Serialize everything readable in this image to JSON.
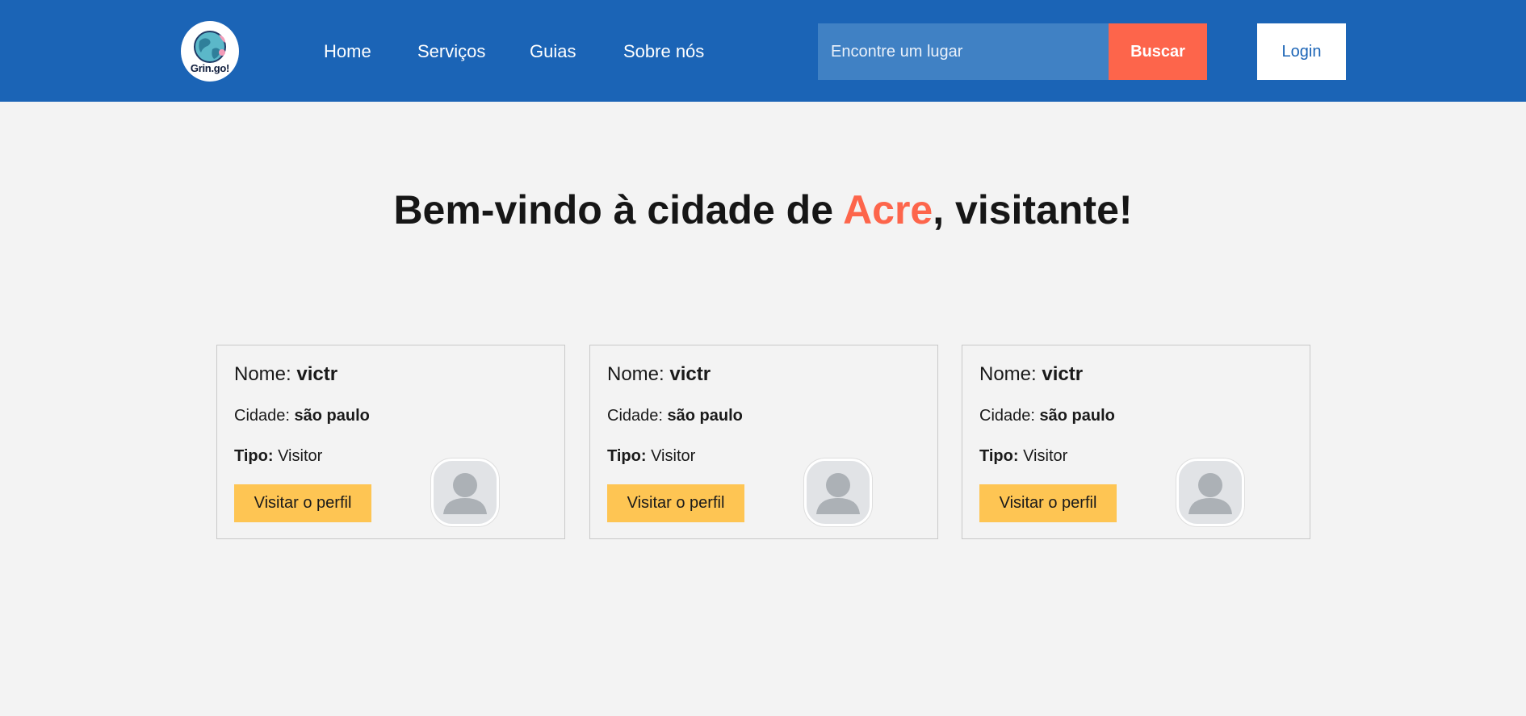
{
  "header": {
    "logo_text": "Grin.go!",
    "logo_icon": "globe-icon",
    "nav": {
      "home": "Home",
      "servicos": "Serviços",
      "guias": "Guias",
      "sobre": "Sobre nós"
    },
    "search": {
      "placeholder": "Encontre um lugar",
      "button_label": "Buscar"
    },
    "login_label": "Login"
  },
  "welcome": {
    "prefix": "Bem-vindo à cidade de ",
    "city": "Acre",
    "suffix": ", visitante!"
  },
  "cards": [
    {
      "name_label": "Nome: ",
      "name": "victr",
      "city_label": "Cidade: ",
      "city": "são paulo",
      "type_label": "Tipo:",
      "type": " Visitor",
      "button_label": "Visitar o perfil",
      "avatar_icon": "user-avatar-icon"
    },
    {
      "name_label": "Nome: ",
      "name": "victr",
      "city_label": "Cidade: ",
      "city": "são paulo",
      "type_label": "Tipo:",
      "type": " Visitor",
      "button_label": "Visitar o perfil",
      "avatar_icon": "user-avatar-icon"
    },
    {
      "name_label": "Nome: ",
      "name": "victr",
      "city_label": "Cidade: ",
      "city": "são paulo",
      "type_label": "Tipo:",
      "type": " Visitor",
      "button_label": "Visitar o perfil",
      "avatar_icon": "user-avatar-icon"
    }
  ],
  "colors": {
    "navbar": "#1b64b6",
    "search_bg": "#4081c4",
    "accent": "#fd654b",
    "button_yellow": "#fec553",
    "page_bg": "#f3f3f3"
  }
}
